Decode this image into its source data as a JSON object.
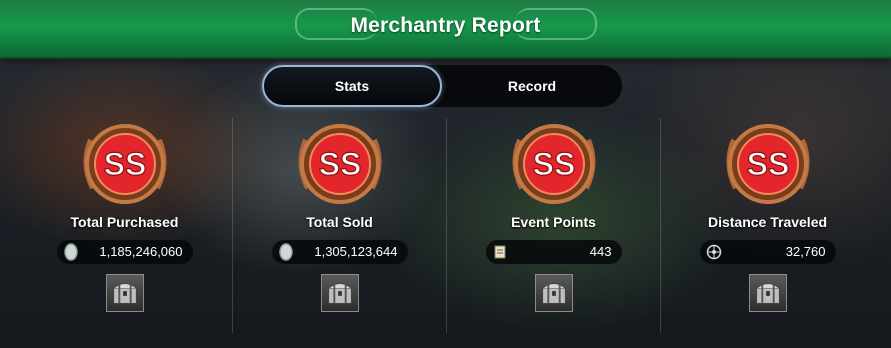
{
  "header": {
    "title": "Merchantry Report"
  },
  "tabs": [
    {
      "label": "Stats",
      "active": true
    },
    {
      "label": "Record",
      "active": false
    }
  ],
  "medal_grade": "SS",
  "stats": [
    {
      "label": "Total Purchased",
      "value": "1,185,246,060",
      "icon": "silver-coin-icon"
    },
    {
      "label": "Total Sold",
      "value": "1,305,123,644",
      "icon": "silver-coin-icon"
    },
    {
      "label": "Event Points",
      "value": "443",
      "icon": "scroll-icon"
    },
    {
      "label": "Distance Traveled",
      "value": "32,760",
      "icon": "compass-wheel-icon"
    }
  ],
  "colors": {
    "banner": "#16994c",
    "medal_red": "#e3262b",
    "medal_bronze": "#b0663a"
  }
}
